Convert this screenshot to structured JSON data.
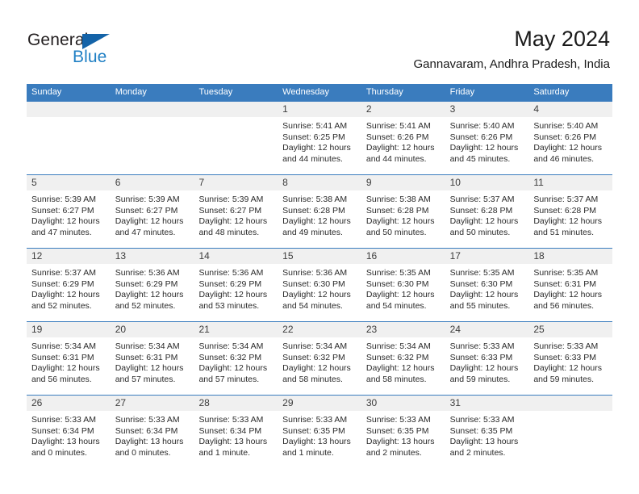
{
  "brand": {
    "name_dark": "General",
    "name_blue": "Blue",
    "color_dark": "#231f20",
    "color_blue": "#1f7fc4",
    "triangle_color": "#1463a8"
  },
  "header": {
    "title": "May 2024",
    "subtitle": "Gannavaram, Andhra Pradesh, India"
  },
  "theme": {
    "header_bar": "#3a7cbe",
    "daynum_band": "#f0f0f0",
    "text": "#1a1a1a"
  },
  "weekdays": [
    "Sunday",
    "Monday",
    "Tuesday",
    "Wednesday",
    "Thursday",
    "Friday",
    "Saturday"
  ],
  "weeks": [
    [
      {
        "day": "",
        "sunrise": "",
        "sunset": "",
        "daylight_line1": "",
        "daylight_line2": ""
      },
      {
        "day": "",
        "sunrise": "",
        "sunset": "",
        "daylight_line1": "",
        "daylight_line2": ""
      },
      {
        "day": "",
        "sunrise": "",
        "sunset": "",
        "daylight_line1": "",
        "daylight_line2": ""
      },
      {
        "day": "1",
        "sunrise": "Sunrise: 5:41 AM",
        "sunset": "Sunset: 6:25 PM",
        "daylight_line1": "Daylight: 12 hours",
        "daylight_line2": "and 44 minutes."
      },
      {
        "day": "2",
        "sunrise": "Sunrise: 5:41 AM",
        "sunset": "Sunset: 6:26 PM",
        "daylight_line1": "Daylight: 12 hours",
        "daylight_line2": "and 44 minutes."
      },
      {
        "day": "3",
        "sunrise": "Sunrise: 5:40 AM",
        "sunset": "Sunset: 6:26 PM",
        "daylight_line1": "Daylight: 12 hours",
        "daylight_line2": "and 45 minutes."
      },
      {
        "day": "4",
        "sunrise": "Sunrise: 5:40 AM",
        "sunset": "Sunset: 6:26 PM",
        "daylight_line1": "Daylight: 12 hours",
        "daylight_line2": "and 46 minutes."
      }
    ],
    [
      {
        "day": "5",
        "sunrise": "Sunrise: 5:39 AM",
        "sunset": "Sunset: 6:27 PM",
        "daylight_line1": "Daylight: 12 hours",
        "daylight_line2": "and 47 minutes."
      },
      {
        "day": "6",
        "sunrise": "Sunrise: 5:39 AM",
        "sunset": "Sunset: 6:27 PM",
        "daylight_line1": "Daylight: 12 hours",
        "daylight_line2": "and 47 minutes."
      },
      {
        "day": "7",
        "sunrise": "Sunrise: 5:39 AM",
        "sunset": "Sunset: 6:27 PM",
        "daylight_line1": "Daylight: 12 hours",
        "daylight_line2": "and 48 minutes."
      },
      {
        "day": "8",
        "sunrise": "Sunrise: 5:38 AM",
        "sunset": "Sunset: 6:28 PM",
        "daylight_line1": "Daylight: 12 hours",
        "daylight_line2": "and 49 minutes."
      },
      {
        "day": "9",
        "sunrise": "Sunrise: 5:38 AM",
        "sunset": "Sunset: 6:28 PM",
        "daylight_line1": "Daylight: 12 hours",
        "daylight_line2": "and 50 minutes."
      },
      {
        "day": "10",
        "sunrise": "Sunrise: 5:37 AM",
        "sunset": "Sunset: 6:28 PM",
        "daylight_line1": "Daylight: 12 hours",
        "daylight_line2": "and 50 minutes."
      },
      {
        "day": "11",
        "sunrise": "Sunrise: 5:37 AM",
        "sunset": "Sunset: 6:28 PM",
        "daylight_line1": "Daylight: 12 hours",
        "daylight_line2": "and 51 minutes."
      }
    ],
    [
      {
        "day": "12",
        "sunrise": "Sunrise: 5:37 AM",
        "sunset": "Sunset: 6:29 PM",
        "daylight_line1": "Daylight: 12 hours",
        "daylight_line2": "and 52 minutes."
      },
      {
        "day": "13",
        "sunrise": "Sunrise: 5:36 AM",
        "sunset": "Sunset: 6:29 PM",
        "daylight_line1": "Daylight: 12 hours",
        "daylight_line2": "and 52 minutes."
      },
      {
        "day": "14",
        "sunrise": "Sunrise: 5:36 AM",
        "sunset": "Sunset: 6:29 PM",
        "daylight_line1": "Daylight: 12 hours",
        "daylight_line2": "and 53 minutes."
      },
      {
        "day": "15",
        "sunrise": "Sunrise: 5:36 AM",
        "sunset": "Sunset: 6:30 PM",
        "daylight_line1": "Daylight: 12 hours",
        "daylight_line2": "and 54 minutes."
      },
      {
        "day": "16",
        "sunrise": "Sunrise: 5:35 AM",
        "sunset": "Sunset: 6:30 PM",
        "daylight_line1": "Daylight: 12 hours",
        "daylight_line2": "and 54 minutes."
      },
      {
        "day": "17",
        "sunrise": "Sunrise: 5:35 AM",
        "sunset": "Sunset: 6:30 PM",
        "daylight_line1": "Daylight: 12 hours",
        "daylight_line2": "and 55 minutes."
      },
      {
        "day": "18",
        "sunrise": "Sunrise: 5:35 AM",
        "sunset": "Sunset: 6:31 PM",
        "daylight_line1": "Daylight: 12 hours",
        "daylight_line2": "and 56 minutes."
      }
    ],
    [
      {
        "day": "19",
        "sunrise": "Sunrise: 5:34 AM",
        "sunset": "Sunset: 6:31 PM",
        "daylight_line1": "Daylight: 12 hours",
        "daylight_line2": "and 56 minutes."
      },
      {
        "day": "20",
        "sunrise": "Sunrise: 5:34 AM",
        "sunset": "Sunset: 6:31 PM",
        "daylight_line1": "Daylight: 12 hours",
        "daylight_line2": "and 57 minutes."
      },
      {
        "day": "21",
        "sunrise": "Sunrise: 5:34 AM",
        "sunset": "Sunset: 6:32 PM",
        "daylight_line1": "Daylight: 12 hours",
        "daylight_line2": "and 57 minutes."
      },
      {
        "day": "22",
        "sunrise": "Sunrise: 5:34 AM",
        "sunset": "Sunset: 6:32 PM",
        "daylight_line1": "Daylight: 12 hours",
        "daylight_line2": "and 58 minutes."
      },
      {
        "day": "23",
        "sunrise": "Sunrise: 5:34 AM",
        "sunset": "Sunset: 6:32 PM",
        "daylight_line1": "Daylight: 12 hours",
        "daylight_line2": "and 58 minutes."
      },
      {
        "day": "24",
        "sunrise": "Sunrise: 5:33 AM",
        "sunset": "Sunset: 6:33 PM",
        "daylight_line1": "Daylight: 12 hours",
        "daylight_line2": "and 59 minutes."
      },
      {
        "day": "25",
        "sunrise": "Sunrise: 5:33 AM",
        "sunset": "Sunset: 6:33 PM",
        "daylight_line1": "Daylight: 12 hours",
        "daylight_line2": "and 59 minutes."
      }
    ],
    [
      {
        "day": "26",
        "sunrise": "Sunrise: 5:33 AM",
        "sunset": "Sunset: 6:34 PM",
        "daylight_line1": "Daylight: 13 hours",
        "daylight_line2": "and 0 minutes."
      },
      {
        "day": "27",
        "sunrise": "Sunrise: 5:33 AM",
        "sunset": "Sunset: 6:34 PM",
        "daylight_line1": "Daylight: 13 hours",
        "daylight_line2": "and 0 minutes."
      },
      {
        "day": "28",
        "sunrise": "Sunrise: 5:33 AM",
        "sunset": "Sunset: 6:34 PM",
        "daylight_line1": "Daylight: 13 hours",
        "daylight_line2": "and 1 minute."
      },
      {
        "day": "29",
        "sunrise": "Sunrise: 5:33 AM",
        "sunset": "Sunset: 6:35 PM",
        "daylight_line1": "Daylight: 13 hours",
        "daylight_line2": "and 1 minute."
      },
      {
        "day": "30",
        "sunrise": "Sunrise: 5:33 AM",
        "sunset": "Sunset: 6:35 PM",
        "daylight_line1": "Daylight: 13 hours",
        "daylight_line2": "and 2 minutes."
      },
      {
        "day": "31",
        "sunrise": "Sunrise: 5:33 AM",
        "sunset": "Sunset: 6:35 PM",
        "daylight_line1": "Daylight: 13 hours",
        "daylight_line2": "and 2 minutes."
      },
      {
        "day": "",
        "sunrise": "",
        "sunset": "",
        "daylight_line1": "",
        "daylight_line2": ""
      }
    ]
  ]
}
